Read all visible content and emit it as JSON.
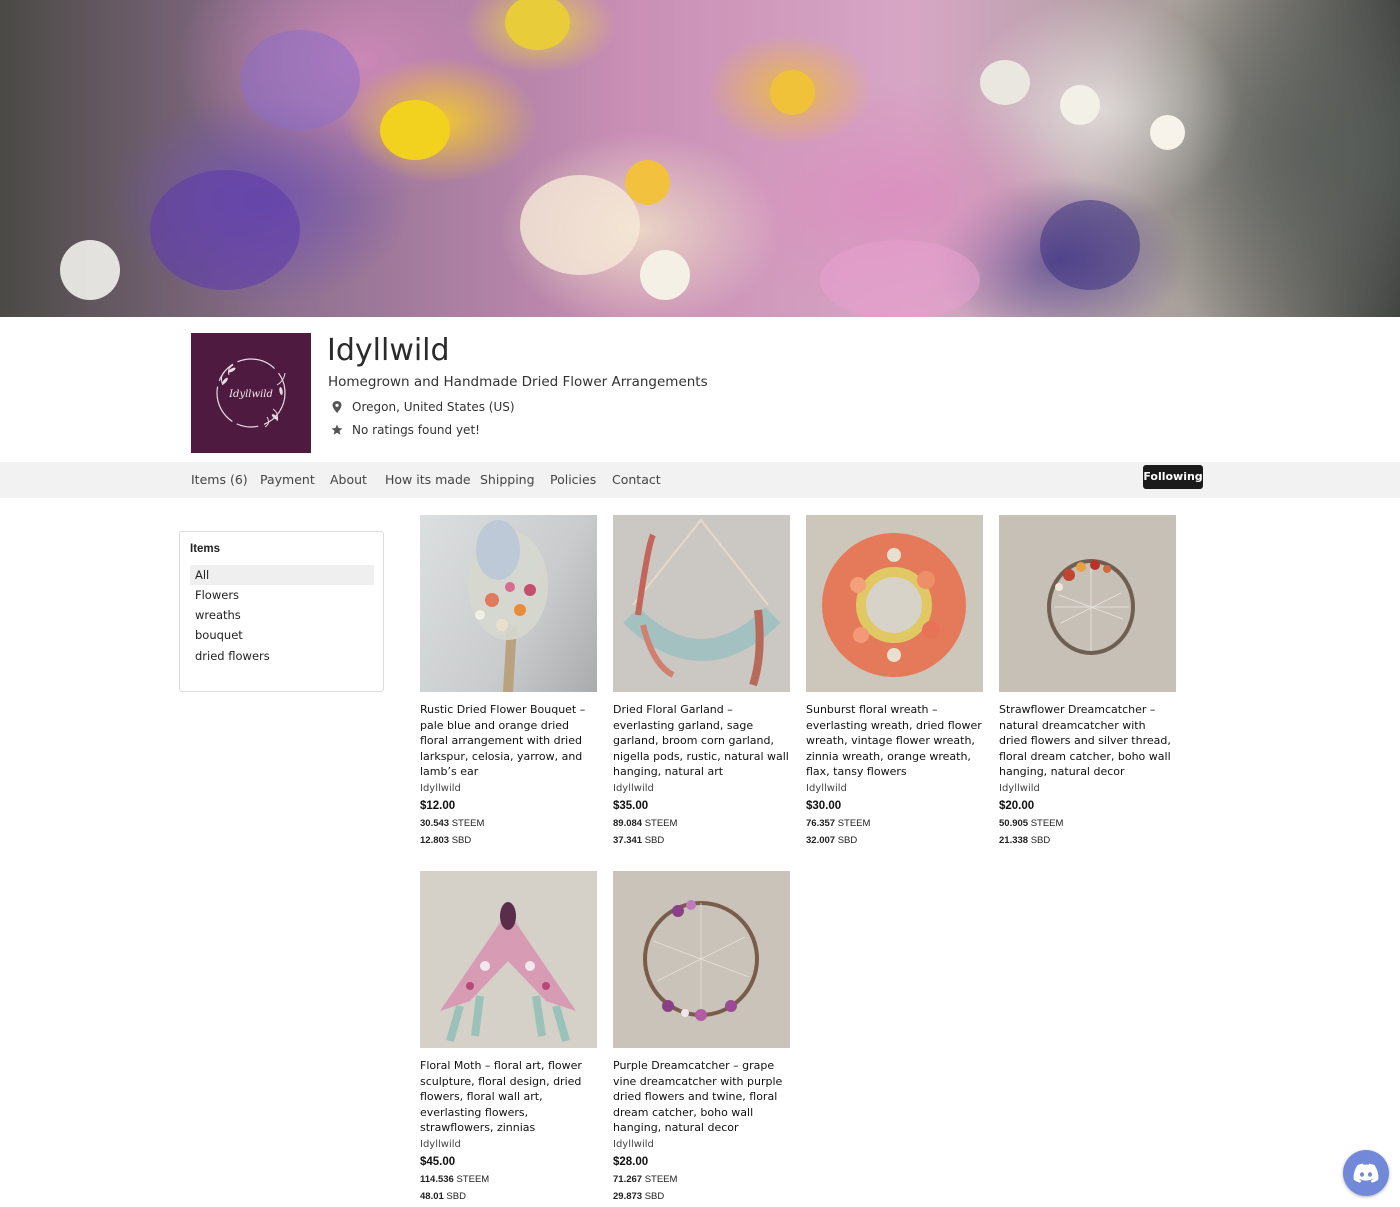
{
  "shop": {
    "name": "Idyllwild",
    "tagline": "Homegrown and Handmade Dried Flower Arrangements",
    "location": "Oregon, United States (US)",
    "rating_text": "No ratings found yet!",
    "logo_text": "Idyllwild",
    "logo_color": "#4e1a40"
  },
  "tabs": [
    {
      "label": "Items (6)"
    },
    {
      "label": "Payment"
    },
    {
      "label": "About"
    },
    {
      "label": "How its made"
    },
    {
      "label": "Shipping"
    },
    {
      "label": "Policies"
    },
    {
      "label": "Contact"
    }
  ],
  "follow_button": {
    "label": "Following"
  },
  "sidebar": {
    "title": "Items",
    "categories": [
      {
        "label": "All",
        "active": true
      },
      {
        "label": "Flowers"
      },
      {
        "label": "wreaths"
      },
      {
        "label": "bouquet"
      },
      {
        "label": "dried flowers"
      }
    ]
  },
  "products": [
    {
      "title": "Rustic Dried Flower Bouquet – pale blue and orange dried floral arrangement with dried larkspur, celosia, yarrow, and lamb’s ear",
      "seller": "Idyllwild",
      "price_usd": "$12.00",
      "steem": "30.543",
      "steem_unit": "STEEM",
      "sbd": "12.803",
      "sbd_unit": "SBD"
    },
    {
      "title": "Dried Floral Garland – everlasting garland, sage garland, broom corn garland, nigella pods, rustic, natural wall hanging, natural art",
      "seller": "Idyllwild",
      "price_usd": "$35.00",
      "steem": "89.084",
      "steem_unit": "STEEM",
      "sbd": "37.341",
      "sbd_unit": "SBD"
    },
    {
      "title": "Sunburst floral wreath – everlasting wreath, dried flower wreath, vintage flower wreath, zinnia wreath, orange wreath, flax, tansy flowers",
      "seller": "Idyllwild",
      "price_usd": "$30.00",
      "steem": "76.357",
      "steem_unit": "STEEM",
      "sbd": "32.007",
      "sbd_unit": "SBD"
    },
    {
      "title": "Strawflower Dreamcatcher – natural dreamcatcher with dried flowers and silver thread, floral dream catcher, boho wall hanging, natural decor",
      "seller": "Idyllwild",
      "price_usd": "$20.00",
      "steem": "50.905",
      "steem_unit": "STEEM",
      "sbd": "21.338",
      "sbd_unit": "SBD"
    },
    {
      "title": "Floral Moth – floral art, flower sculpture, floral design, dried flowers, floral wall art, everlasting flowers, strawflowers, zinnias",
      "seller": "Idyllwild",
      "price_usd": "$45.00",
      "steem": "114.536",
      "steem_unit": "STEEM",
      "sbd": "48.01",
      "sbd_unit": "SBD"
    },
    {
      "title": "Purple Dreamcatcher – grape vine dreamcatcher with purple dried flowers and twine, floral dream catcher, boho wall hanging, natural decor",
      "seller": "Idyllwild",
      "price_usd": "$28.00",
      "steem": "71.267",
      "steem_unit": "STEEM",
      "sbd": "29.873",
      "sbd_unit": "SBD"
    }
  ],
  "icons": {
    "location": "map-pin-icon",
    "rating": "star-icon",
    "chat": "discord-icon"
  },
  "colors": {
    "tab_bar_bg": "#f2f2f2",
    "follow_bg": "#1b1b1b",
    "discord": "#7289da"
  }
}
